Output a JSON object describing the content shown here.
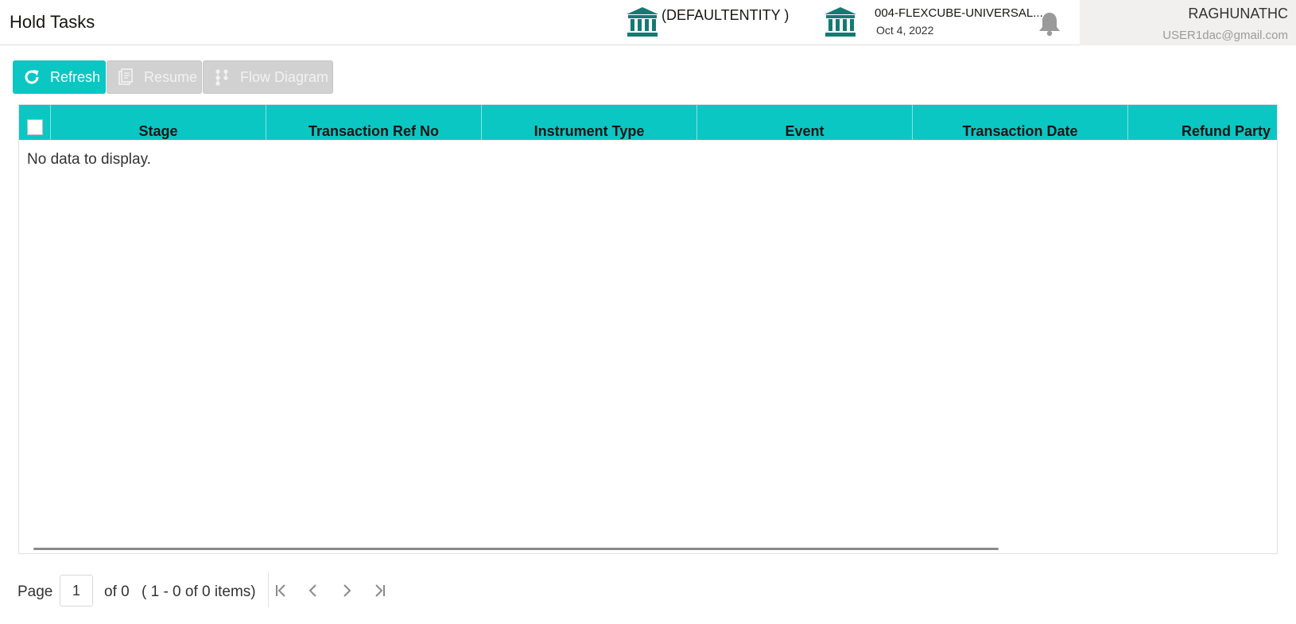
{
  "header": {
    "page_title": "Hold Tasks",
    "entity": "(DEFAULTENTITY )",
    "branch_name": "004-FLEXCUBE-UNIVERSAL...",
    "branch_date": "Oct 4, 2022",
    "user_name": "RAGHUNATHC",
    "user_email": "USER1dac@gmail.com"
  },
  "toolbar": {
    "refresh_label": "Refresh",
    "resume_label": "Resume",
    "flow_diagram_label": "Flow Diagram"
  },
  "grid": {
    "columns": [
      "Stage",
      "Transaction Ref No",
      "Instrument Type",
      "Event",
      "Transaction Date",
      "Refund Party"
    ],
    "empty_message": "No data to display."
  },
  "pager": {
    "page_label": "Page",
    "current_page": "1",
    "of_label": "of 0",
    "items_label": "( 1 - 0 of 0 items)"
  },
  "colors": {
    "accent": "#0ac7c4",
    "icon_teal": "#147a72",
    "disabled": "#d1d1d1"
  },
  "icons": [
    "bank-icon",
    "bell-icon",
    "refresh-icon",
    "resume-icon",
    "flow-diagram-icon",
    "first-page-icon",
    "prev-page-icon",
    "next-page-icon",
    "last-page-icon"
  ]
}
